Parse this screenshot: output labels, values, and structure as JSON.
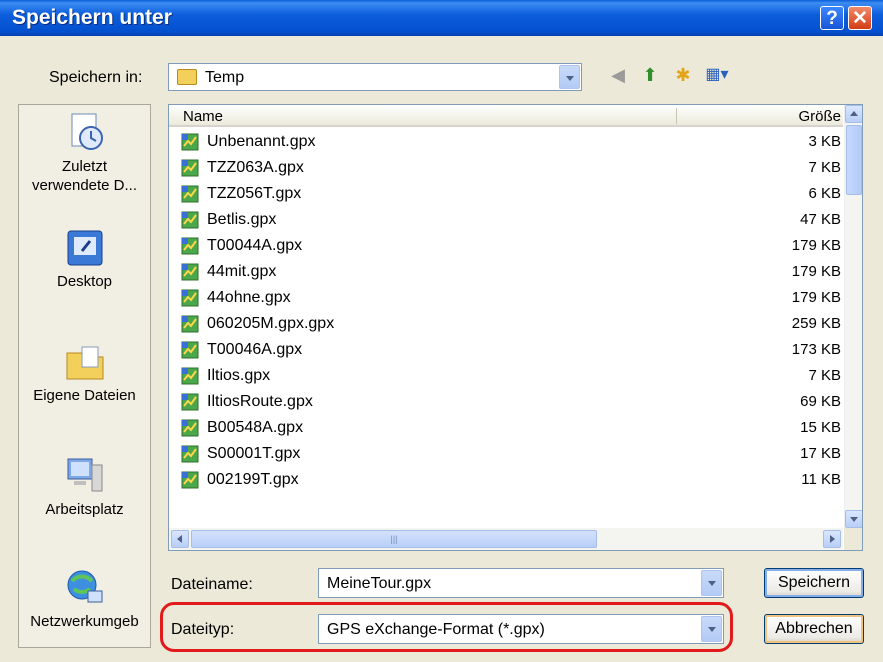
{
  "window": {
    "title": "Speichern unter"
  },
  "toolbar": {
    "save_in_label": "Speichern in:",
    "save_in_value": "Temp"
  },
  "places": [
    {
      "label": "Zuletzt verwendete D..."
    },
    {
      "label": "Desktop"
    },
    {
      "label": "Eigene Dateien"
    },
    {
      "label": "Arbeitsplatz"
    },
    {
      "label": "Netzwerkumgeb"
    }
  ],
  "list": {
    "header_name": "Name",
    "header_size": "Größe",
    "files": [
      {
        "name": "Unbenannt.gpx",
        "size": "3 KB"
      },
      {
        "name": "TZZ063A.gpx",
        "size": "7 KB"
      },
      {
        "name": "TZZ056T.gpx",
        "size": "6 KB"
      },
      {
        "name": "Betlis.gpx",
        "size": "47 KB"
      },
      {
        "name": "T00044A.gpx",
        "size": "179 KB"
      },
      {
        "name": "44mit.gpx",
        "size": "179 KB"
      },
      {
        "name": "44ohne.gpx",
        "size": "179 KB"
      },
      {
        "name": "060205M.gpx.gpx",
        "size": "259 KB"
      },
      {
        "name": "T00046A.gpx",
        "size": "173 KB"
      },
      {
        "name": "Iltios.gpx",
        "size": "7 KB"
      },
      {
        "name": "IltiosRoute.gpx",
        "size": "69 KB"
      },
      {
        "name": "B00548A.gpx",
        "size": "15 KB"
      },
      {
        "name": "S00001T.gpx",
        "size": "17 KB"
      },
      {
        "name": "002199T.gpx",
        "size": "11 KB"
      }
    ]
  },
  "form": {
    "filename_label": "Dateiname:",
    "filename_value": "MeineTour.gpx",
    "filetype_label": "Dateityp:",
    "filetype_value": "GPS eXchange-Format (*.gpx)"
  },
  "buttons": {
    "save": "Speichern",
    "cancel": "Abbrechen"
  },
  "colors": {
    "title_bar": "#0a54d6",
    "highlight": "#e11b1b"
  }
}
